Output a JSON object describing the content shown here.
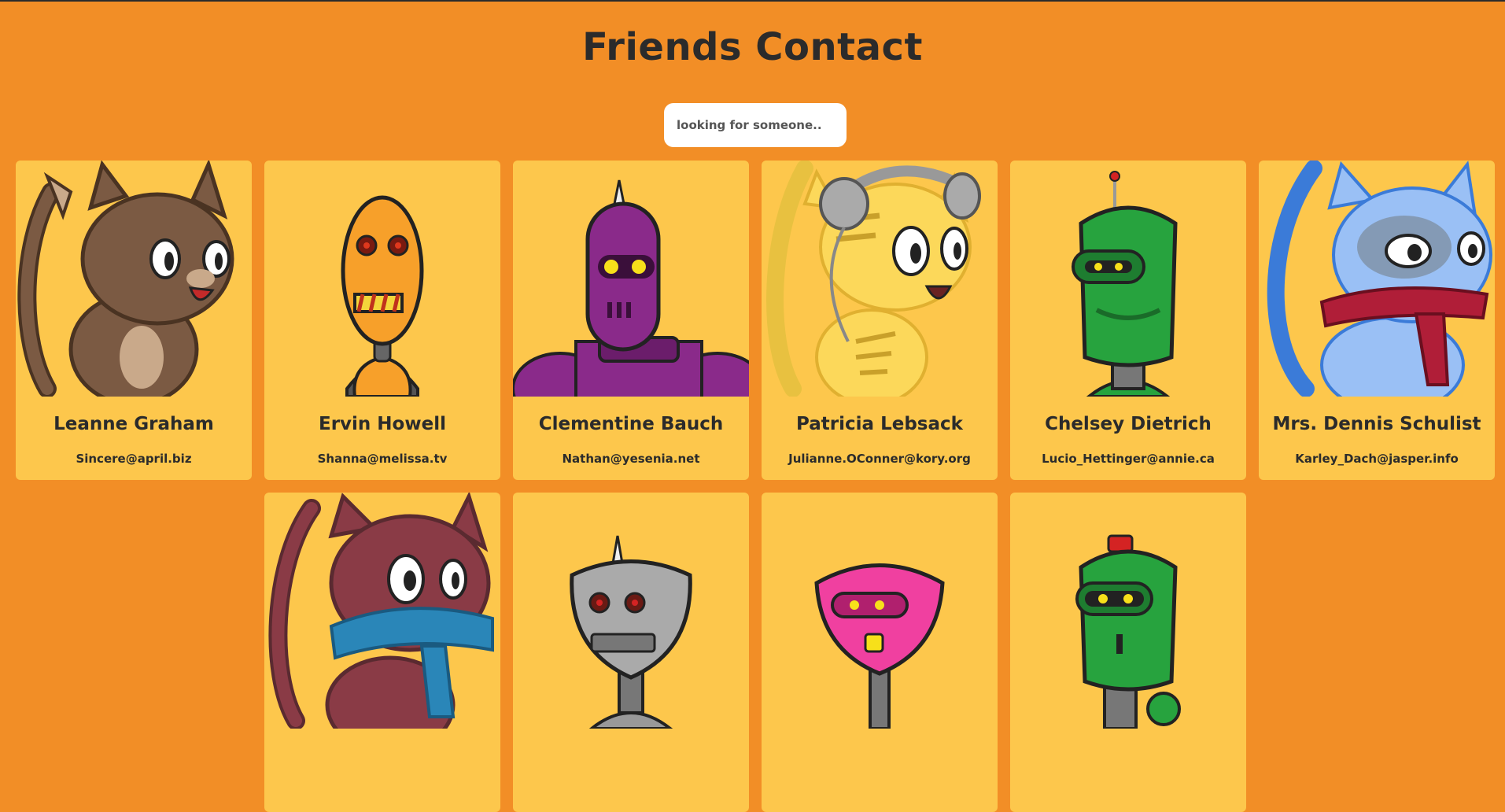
{
  "page": {
    "title": "Friends Contact"
  },
  "search": {
    "placeholder": "looking for someone...?"
  },
  "friends": [
    {
      "name": "Leanne Graham",
      "email": "Sincere@april.biz",
      "avatar": "brown-cat-icon"
    },
    {
      "name": "Ervin Howell",
      "email": "Shanna@melissa.tv",
      "avatar": "orange-robot-icon"
    },
    {
      "name": "Clementine Bauch",
      "email": "Nathan@yesenia.net",
      "avatar": "purple-robot-icon"
    },
    {
      "name": "Patricia Lebsack",
      "email": "Julianne.OConner@kory.org",
      "avatar": "yellow-cat-headphones-icon"
    },
    {
      "name": "Chelsey Dietrich",
      "email": "Lucio_Hettinger@annie.ca",
      "avatar": "green-robot-antenna-icon"
    },
    {
      "name": "Mrs. Dennis Schulist",
      "email": "Karley_Dach@jasper.info",
      "avatar": "blue-cat-scarf-icon"
    },
    {
      "name": "",
      "email": "",
      "avatar": "maroon-cat-scarf-icon"
    },
    {
      "name": "",
      "email": "",
      "avatar": "gray-robot-icon"
    },
    {
      "name": "",
      "email": "",
      "avatar": "pink-robot-icon"
    },
    {
      "name": "",
      "email": "",
      "avatar": "green-robot-hat-icon"
    }
  ],
  "colors": {
    "background": "#f28e26",
    "card": "#fdc74c",
    "text": "#2b2b2b"
  }
}
